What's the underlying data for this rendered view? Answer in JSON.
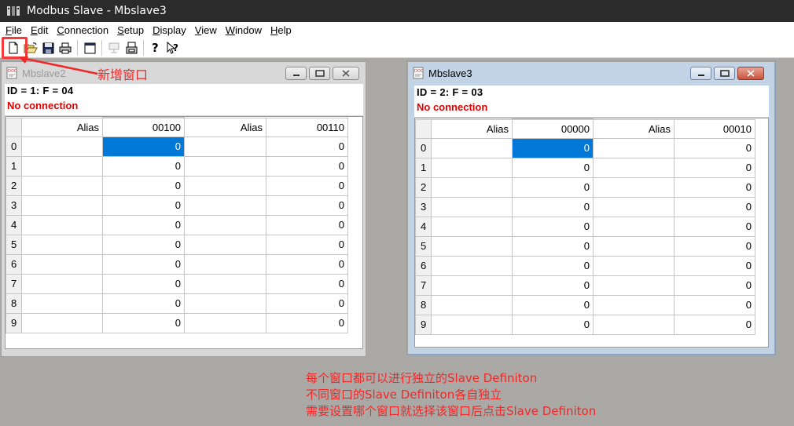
{
  "app": {
    "title": "Modbus Slave - Mbslave3"
  },
  "menu": [
    {
      "mnemonic": "F",
      "rest": "ile"
    },
    {
      "mnemonic": "E",
      "rest": "dit"
    },
    {
      "mnemonic": "C",
      "rest": "onnection"
    },
    {
      "mnemonic": "S",
      "rest": "etup"
    },
    {
      "mnemonic": "D",
      "rest": "isplay"
    },
    {
      "mnemonic": "V",
      "rest": "iew"
    },
    {
      "mnemonic": "W",
      "rest": "indow"
    },
    {
      "mnemonic": "H",
      "rest": "elp"
    }
  ],
  "toolbar": {
    "icons": [
      "new-document-icon",
      "open-folder-icon",
      "save-icon",
      "print-icon",
      "window-icon",
      "connect-icon",
      "disconnect-icon",
      "help-icon",
      "context-help-icon"
    ]
  },
  "annotation": {
    "label": "新增窗口",
    "notes": [
      "每个窗口都可以进行独立的Slave Definiton",
      "不同窗口的Slave Definiton各自独立",
      "需要设置哪个窗口就选择该窗口后点击Slave Definiton"
    ],
    "color": "#f02828"
  },
  "windows": [
    {
      "title": "Mbslave2",
      "active": false,
      "id_line": "ID = 1: F = 04",
      "status": "No connection",
      "columns": [
        "Alias",
        "00100",
        "Alias",
        "00110"
      ],
      "rows": [
        {
          "index": "0",
          "values": [
            "",
            "0",
            "",
            "0"
          ]
        },
        {
          "index": "1",
          "values": [
            "",
            "0",
            "",
            "0"
          ]
        },
        {
          "index": "2",
          "values": [
            "",
            "0",
            "",
            "0"
          ]
        },
        {
          "index": "3",
          "values": [
            "",
            "0",
            "",
            "0"
          ]
        },
        {
          "index": "4",
          "values": [
            "",
            "0",
            "",
            "0"
          ]
        },
        {
          "index": "5",
          "values": [
            "",
            "0",
            "",
            "0"
          ]
        },
        {
          "index": "6",
          "values": [
            "",
            "0",
            "",
            "0"
          ]
        },
        {
          "index": "7",
          "values": [
            "",
            "0",
            "",
            "0"
          ]
        },
        {
          "index": "8",
          "values": [
            "",
            "0",
            "",
            "0"
          ]
        },
        {
          "index": "9",
          "values": [
            "",
            "0",
            "",
            "0"
          ]
        }
      ]
    },
    {
      "title": "Mbslave3",
      "active": true,
      "id_line": "ID = 2: F = 03",
      "status": "No connection",
      "columns": [
        "Alias",
        "00000",
        "Alias",
        "00010"
      ],
      "rows": [
        {
          "index": "0",
          "values": [
            "",
            "0",
            "",
            "0"
          ]
        },
        {
          "index": "1",
          "values": [
            "",
            "0",
            "",
            "0"
          ]
        },
        {
          "index": "2",
          "values": [
            "",
            "0",
            "",
            "0"
          ]
        },
        {
          "index": "3",
          "values": [
            "",
            "0",
            "",
            "0"
          ]
        },
        {
          "index": "4",
          "values": [
            "",
            "0",
            "",
            "0"
          ]
        },
        {
          "index": "5",
          "values": [
            "",
            "0",
            "",
            "0"
          ]
        },
        {
          "index": "6",
          "values": [
            "",
            "0",
            "",
            "0"
          ]
        },
        {
          "index": "7",
          "values": [
            "",
            "0",
            "",
            "0"
          ]
        },
        {
          "index": "8",
          "values": [
            "",
            "0",
            "",
            "0"
          ]
        },
        {
          "index": "9",
          "values": [
            "",
            "0",
            "",
            "0"
          ]
        }
      ]
    }
  ],
  "colors": {
    "selection": "#0078d7",
    "status_error": "#e00000"
  }
}
